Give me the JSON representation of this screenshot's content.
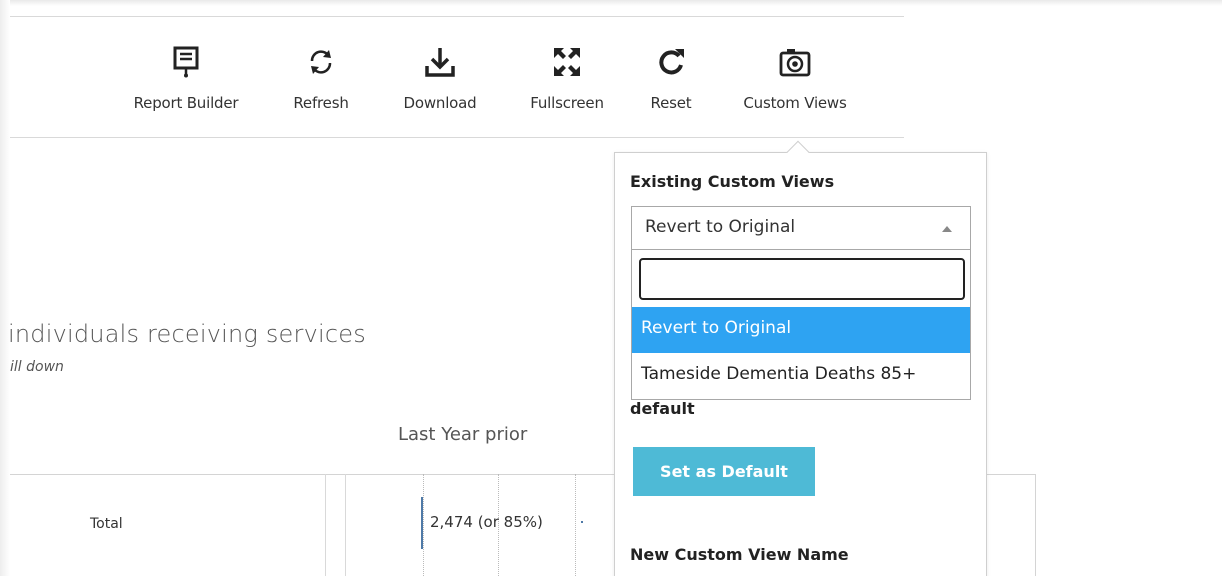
{
  "toolbar": {
    "items": [
      {
        "label": "Report Builder",
        "icon": "presentation-board-icon"
      },
      {
        "label": "Refresh",
        "icon": "refresh-icon"
      },
      {
        "label": "Download",
        "icon": "download-icon"
      },
      {
        "label": "Fullscreen",
        "icon": "fullscreen-icon"
      },
      {
        "label": "Reset",
        "icon": "reset-icon"
      },
      {
        "label": "Custom Views",
        "icon": "camera-icon"
      }
    ]
  },
  "content": {
    "title": "individuals receiving services",
    "subtitle": "ill down",
    "column_header": "Last Year prior",
    "row": {
      "label": "Total",
      "value": "2,474 (or 85%)"
    }
  },
  "custom_views": {
    "existing_label": "Existing Custom Views",
    "selected": "Revert to Original",
    "search_placeholder": "",
    "options": [
      "Revert to Original",
      "Tameside Dementia Deaths 85+"
    ],
    "default_label": "default",
    "set_default_button": "Set as Default",
    "new_name_label": "New Custom View Name"
  },
  "colors": {
    "accent_selected": "#2ea3f2",
    "button": "#4ebad6",
    "bar": "#4e79a7"
  }
}
